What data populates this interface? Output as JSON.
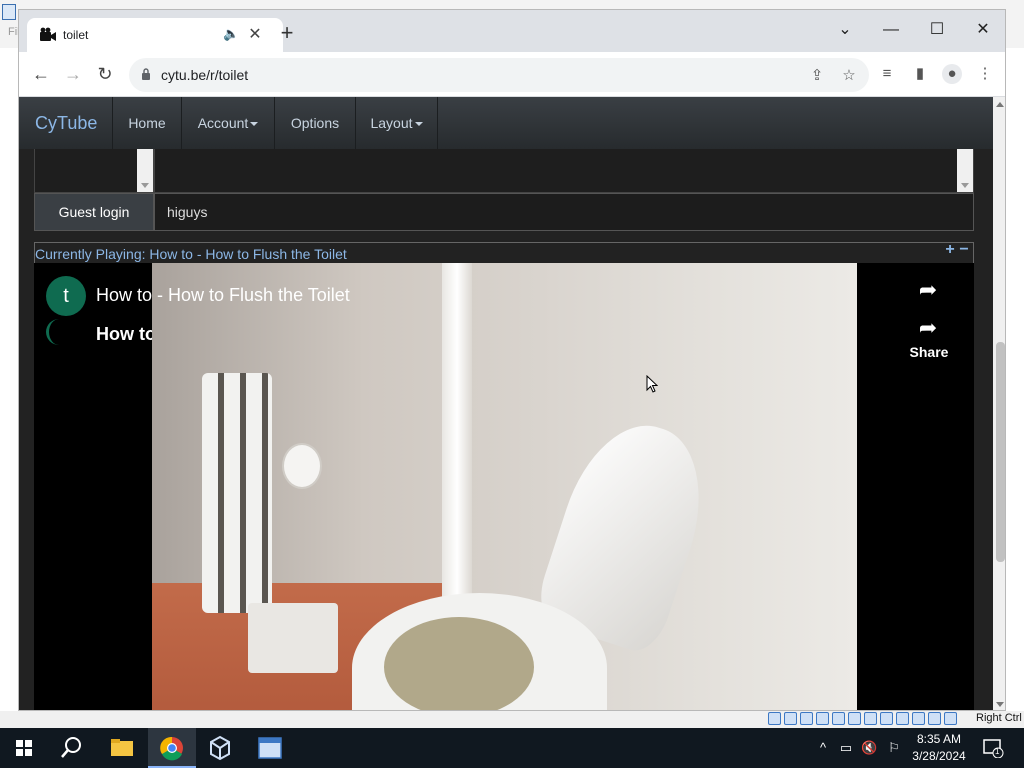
{
  "host": {
    "title_fragment": "File"
  },
  "browser": {
    "tab": {
      "title": "toilet",
      "audio_icon": "speaker-icon",
      "close_label": "✕"
    },
    "new_tab_label": "+",
    "window": {
      "tabsearch_label": "⌄",
      "minimize_label": "—",
      "maximize_label": "☐",
      "close_label": "✕"
    },
    "url": "cytu.be/r/toilet"
  },
  "navbar": {
    "brand": "CyTube",
    "items": [
      {
        "label": "Home"
      },
      {
        "label": "Account"
      },
      {
        "label": "Options"
      },
      {
        "label": "Layout"
      }
    ]
  },
  "chat": {
    "guest_login_label": "Guest login",
    "input_value": "higuys"
  },
  "now_playing": {
    "prefix": "Currently Playing:",
    "title": "How to - How to Flush the Toilet"
  },
  "video": {
    "channel_avatar_letter": "t",
    "title": "How to - How to Flush the Toilet",
    "subtitle": "How to",
    "share_label": "Share"
  },
  "vbox": {
    "host_key": "Right Ctrl"
  },
  "taskbar": {
    "time": "8:35 AM",
    "date": "3/28/2024",
    "notifications": "1"
  }
}
